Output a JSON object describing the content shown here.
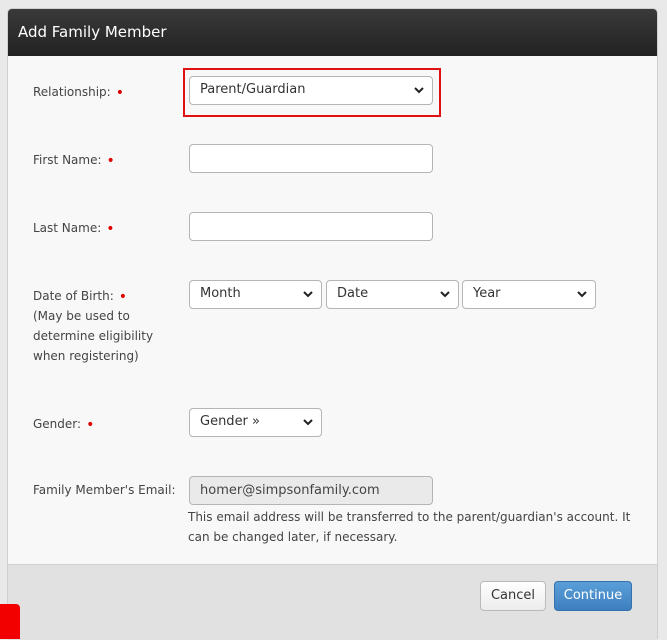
{
  "dialog": {
    "title": "Add Family Member"
  },
  "form": {
    "relationship": {
      "label": "Relationship:",
      "value": "Parent/Guardian"
    },
    "first_name": {
      "label": "First Name:",
      "value": ""
    },
    "last_name": {
      "label": "Last Name:",
      "value": ""
    },
    "dob": {
      "label": "Date of Birth:",
      "note_line1": "(May be used to",
      "note_line2": "determine eligibility",
      "note_line3": "when registering)",
      "month": "Month",
      "day": "Date",
      "year": "Year"
    },
    "gender": {
      "label": "Gender:",
      "value": "Gender »"
    },
    "email": {
      "label": "Family Member's Email:",
      "value": "homer@simpsonfamily.com",
      "note": "This email address will be transferred to the parent/guardian's account. It can be changed later, if necessary."
    },
    "required_mark": "•"
  },
  "footer": {
    "cancel_label": "Cancel",
    "continue_label": "Continue"
  },
  "colors": {
    "header": "#2b2b2b",
    "required": "#e00000",
    "highlight": "#e01010",
    "primary": "#4a8ccb"
  }
}
